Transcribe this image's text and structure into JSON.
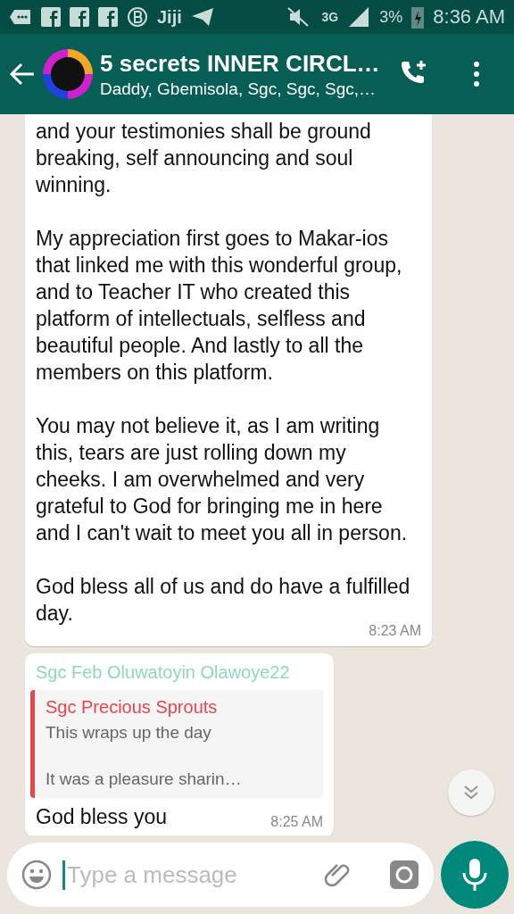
{
  "status_bar": {
    "app_label": "Jiji",
    "network": "3G",
    "battery": "3%",
    "time": "8:36 AM"
  },
  "header": {
    "title": "5 secrets INNER CIRCL…",
    "subtitle": "Daddy, Gbemisola, Sgc, Sgc, Sgc,…"
  },
  "messages": [
    {
      "kind": "text",
      "paragraphs": [
        "and your testimonies shall be ground breaking, self announcing and soul winning.",
        "My appreciation first goes to Makar-ios that linked me with this wonderful group, and to Teacher IT who created this platform of intellectuals,  selfless and beautiful people. And lastly to all the members on this platform.",
        "You may not believe it, as I am writing this, tears are just rolling down my cheeks. I am overwhelmed and very grateful to God for bringing me in here and I can't  wait to meet you all in person.",
        "God bless all of us and do have a fulfilled day."
      ],
      "time": "8:23 AM"
    },
    {
      "kind": "reply",
      "sender": "Sgc Feb Oluwatoyin Olawoye22",
      "quote": {
        "author": "Sgc Precious Sprouts",
        "lines": [
          "This wraps up the day",
          "It was a pleasure sharin…"
        ]
      },
      "text": "God bless you",
      "time": "8:25 AM"
    }
  ],
  "composer": {
    "placeholder": "Type a message"
  }
}
